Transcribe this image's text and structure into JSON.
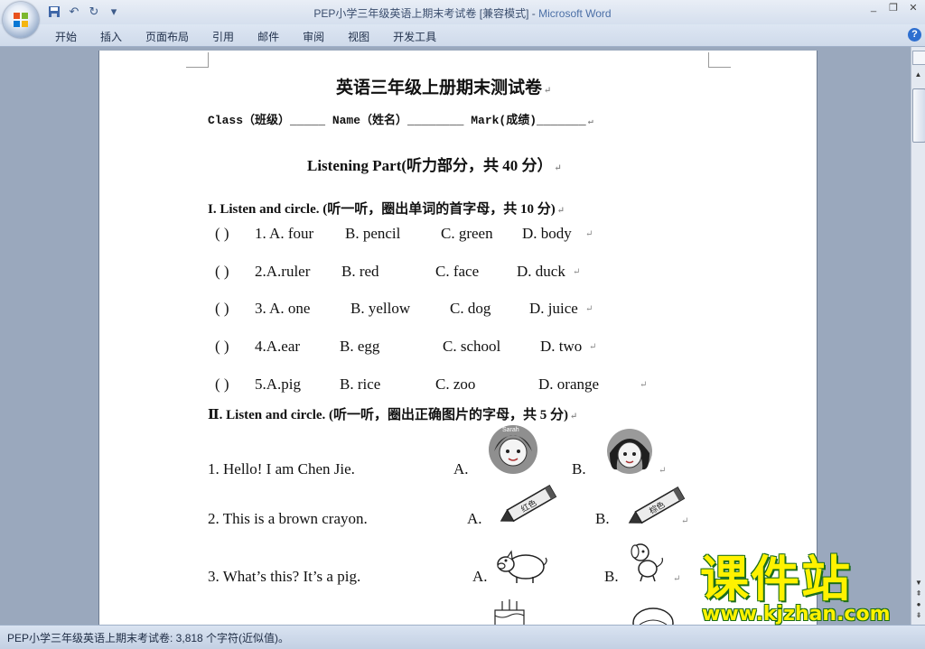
{
  "window": {
    "title_doc": "PEP小学三年级英语上期末考试卷 [兼容模式] - ",
    "title_app": "Microsoft Word",
    "controls": [
      "_",
      "❐",
      "✕"
    ]
  },
  "quick_access": {
    "save_icon": "save-icon",
    "undo_icon": "undo-icon",
    "redo_icon": "redo-icon",
    "customize_icon": "chevron-down-icon"
  },
  "ribbon": {
    "tabs": [
      "开始",
      "插入",
      "页面布局",
      "引用",
      "邮件",
      "审阅",
      "视图",
      "开发工具"
    ],
    "help": "?"
  },
  "document": {
    "title": "英语三年级上册期末测试卷",
    "header_line": "Class（班级）_____  Name（姓名）________  Mark(成绩)_______",
    "listening_title": "Listening Part(听力部分，共 40 分）",
    "section1_title": "I. Listen and circle. (听一听，圈出单词的首字母，共 10 分)",
    "section1_items": [
      {
        "bracket": "(     )",
        "num": "1. A. four",
        "b": "B. pencil",
        "c": "C. green",
        "d": "D. body"
      },
      {
        "bracket": "(     )",
        "num": "2.A.ruler",
        "b": "B. red",
        "c": "C. face",
        "d": "D. duck"
      },
      {
        "bracket": "(     )",
        "num": "3. A. one",
        "b": "B. yellow",
        "c": "C. dog",
        "d": "D. juice"
      },
      {
        "bracket": "(     )",
        "num": "4.A.ear",
        "b": "B. egg",
        "c": "C. school",
        "d": "D. two"
      },
      {
        "bracket": "(     )",
        "num": "5.A.pig",
        "b": "B. rice",
        "c": "C. zoo",
        "d": "D. orange"
      }
    ],
    "section2_title": "Ⅱ. Listen and circle. (听一听，圈出正确图片的字母，共 5 分)",
    "section2_items": [
      {
        "sentence": "1. Hello! I am Chen Jie.",
        "a": "A.",
        "b": "B."
      },
      {
        "sentence": "2. This is a brown crayon.",
        "a": "A.",
        "b": "B."
      },
      {
        "sentence": "3. What’s this?   It’s a pig.",
        "a": "A.",
        "b": "B."
      }
    ],
    "picture_labels": {
      "girl_a": "Sarah",
      "crayon_a": "红色",
      "crayon_b": "棕色"
    },
    "para_mark": "↵"
  },
  "statusbar": {
    "text": "PEP小学三年级英语上期末考试卷: 3,818 个字符(近似值)。"
  },
  "watermark": {
    "cn": "课件站",
    "url": "www.kjzhan.com"
  },
  "colors": {
    "accent": "#4b6fa6",
    "watermark_fill": "#fff200",
    "watermark_outline": "#1b6d1b"
  }
}
